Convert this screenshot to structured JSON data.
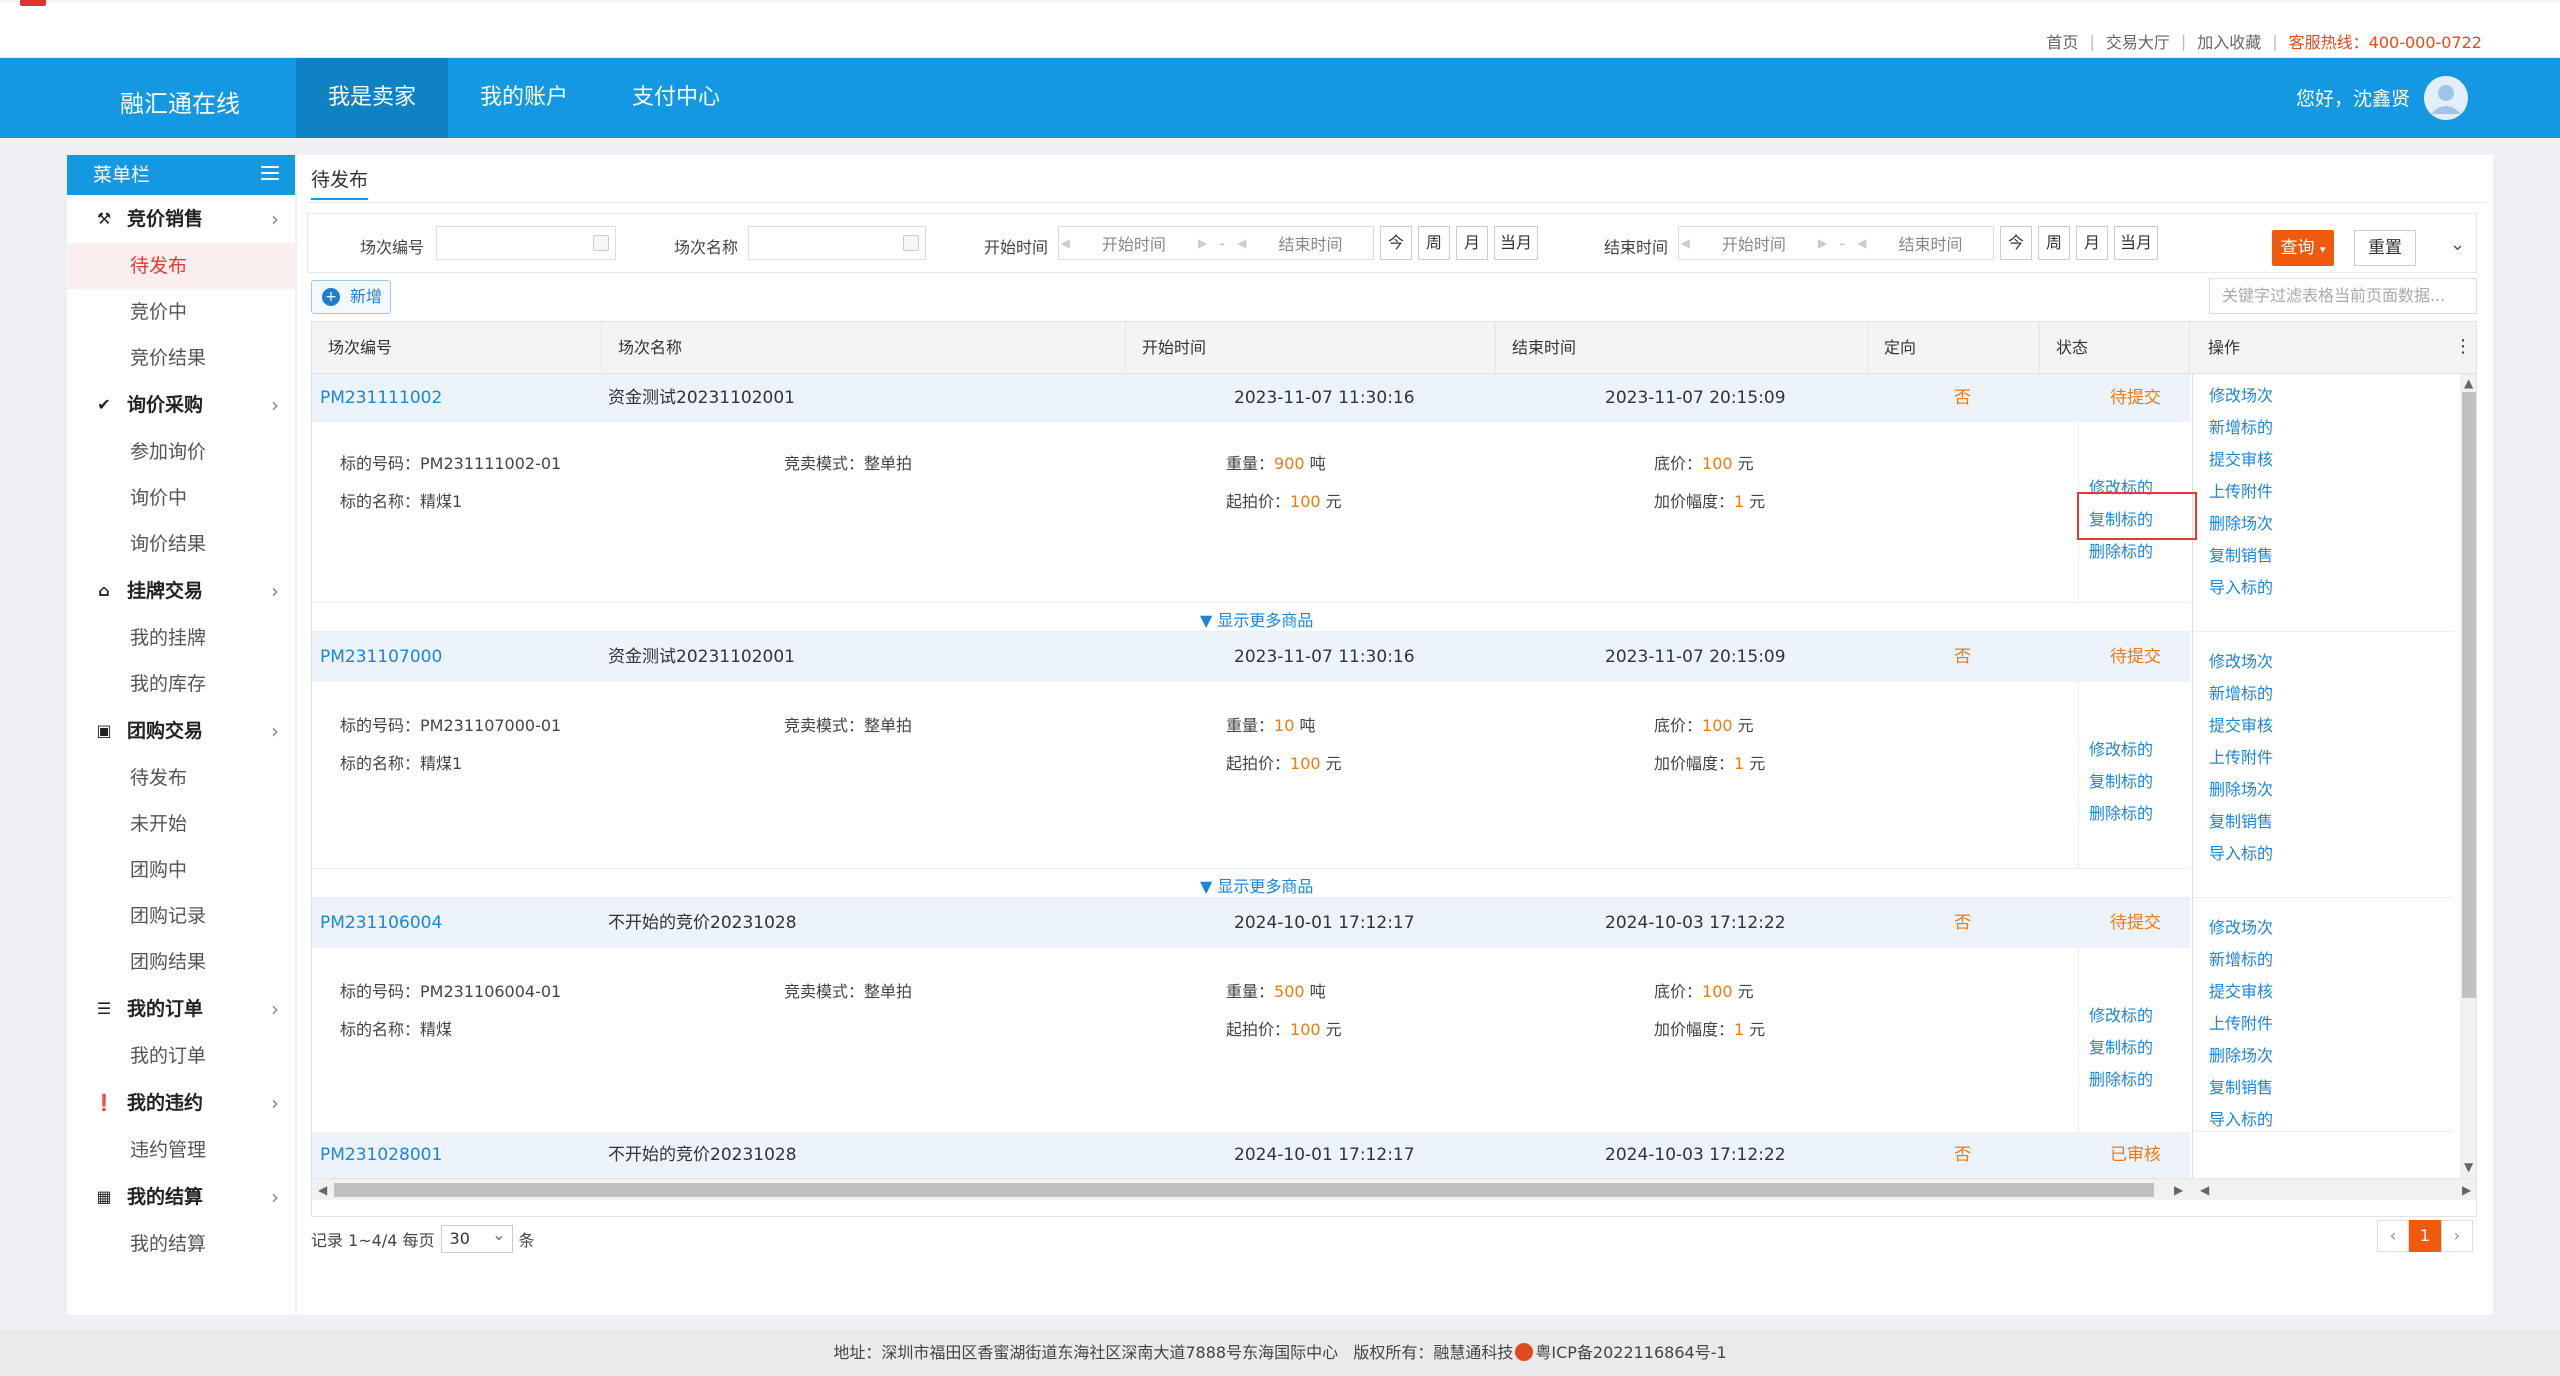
{
  "toplinks": {
    "home": "首页",
    "hall": "交易大厅",
    "fav": "加入收藏",
    "hotline": "客服热线：400-000-0722"
  },
  "header": {
    "brand": "融汇通在线",
    "nav": [
      "我是卖家",
      "我的账户",
      "支付中心"
    ],
    "greeting": "您好，沈鑫贤"
  },
  "sidebar": {
    "title": "菜单栏",
    "groups": [
      {
        "label": "竞价销售",
        "items": [
          "待发布",
          "竞价中",
          "竞价结果"
        ]
      },
      {
        "label": "询价采购",
        "items": [
          "参加询价",
          "询价中",
          "询价结果"
        ]
      },
      {
        "label": "挂牌交易",
        "items": [
          "我的挂牌",
          "我的库存"
        ]
      },
      {
        "label": "团购交易",
        "items": [
          "待发布",
          "未开始",
          "团购中",
          "团购记录",
          "团购结果"
        ]
      },
      {
        "label": "我的订单",
        "items": [
          "我的订单"
        ]
      },
      {
        "label": "我的违约",
        "items": [
          "违约管理"
        ]
      },
      {
        "label": "我的结算",
        "items": [
          "我的结算"
        ]
      }
    ]
  },
  "tab": "待发布",
  "filter": {
    "code_label": "场次编号",
    "name_label": "场次名称",
    "start_label": "开始时间",
    "end_label": "结束时间",
    "start_ph": "开始时间",
    "end_ph": "结束时间",
    "dash": "-",
    "quick": [
      "今",
      "周",
      "月",
      "当月"
    ],
    "query": "查询",
    "reset": "重置"
  },
  "toolbar": {
    "new": "新增",
    "search_ph": "关键字过滤表格当前页面数据..."
  },
  "columns": [
    "场次编号",
    "场次名称",
    "开始时间",
    "结束时间",
    "定向",
    "状态",
    "操作"
  ],
  "labels": {
    "code": "标的号码：",
    "mode": "竞卖模式：",
    "weight": "重量：",
    "reserve": "底价：",
    "name": "标的名称：",
    "start_price": "起拍价：",
    "increment": "加价幅度：",
    "ton": "吨",
    "yuan": "元",
    "more": "显示更多商品"
  },
  "row_actions": [
    "修改标的",
    "复制标的",
    "删除标的"
  ],
  "ops": [
    "修改场次",
    "新增标的",
    "提交审核",
    "上传附件",
    "删除场次",
    "复制销售",
    "导入标的"
  ],
  "rows": [
    {
      "code": "PM231111002",
      "name": "资金测试20231102001",
      "start": "2023-11-07 11:30:16",
      "end": "2023-11-07 20:15:09",
      "directed": "否",
      "status": "待提交",
      "item_code": "PM231111002-01",
      "mode": "整单拍",
      "weight": "900",
      "reserve": "100",
      "item_name": "精煤1",
      "start_price": "100",
      "increment": "1"
    },
    {
      "code": "PM231107000",
      "name": "资金测试20231102001",
      "start": "2023-11-07 11:30:16",
      "end": "2023-11-07 20:15:09",
      "directed": "否",
      "status": "待提交",
      "item_code": "PM231107000-01",
      "mode": "整单拍",
      "weight": "10",
      "reserve": "100",
      "item_name": "精煤1",
      "start_price": "100",
      "increment": "1"
    },
    {
      "code": "PM231106004",
      "name": "不开始的竞价20231028",
      "start": "2024-10-01 17:12:17",
      "end": "2024-10-03 17:12:22",
      "directed": "否",
      "status": "待提交",
      "item_code": "PM231106004-01",
      "mode": "整单拍",
      "weight": "500",
      "reserve": "100",
      "item_name": "精煤",
      "start_price": "100",
      "increment": "1"
    },
    {
      "code": "PM231028001",
      "name": "不开始的竞价20231028",
      "start": "2024-10-01 17:12:17",
      "end": "2024-10-03 17:12:22",
      "directed": "否",
      "status": "已审核"
    }
  ],
  "pager": {
    "records": "记录 1~4/4 每页",
    "size": "30",
    "unit": "条",
    "current": "1",
    "prev": "‹",
    "next": "›"
  },
  "footer": {
    "address": "地址：深圳市福田区香蜜湖街道东海社区深南大道7888号东海国际中心",
    "copyright": "版权所有：融慧通科技",
    "icp": "粤ICP备2022116864号-1"
  }
}
